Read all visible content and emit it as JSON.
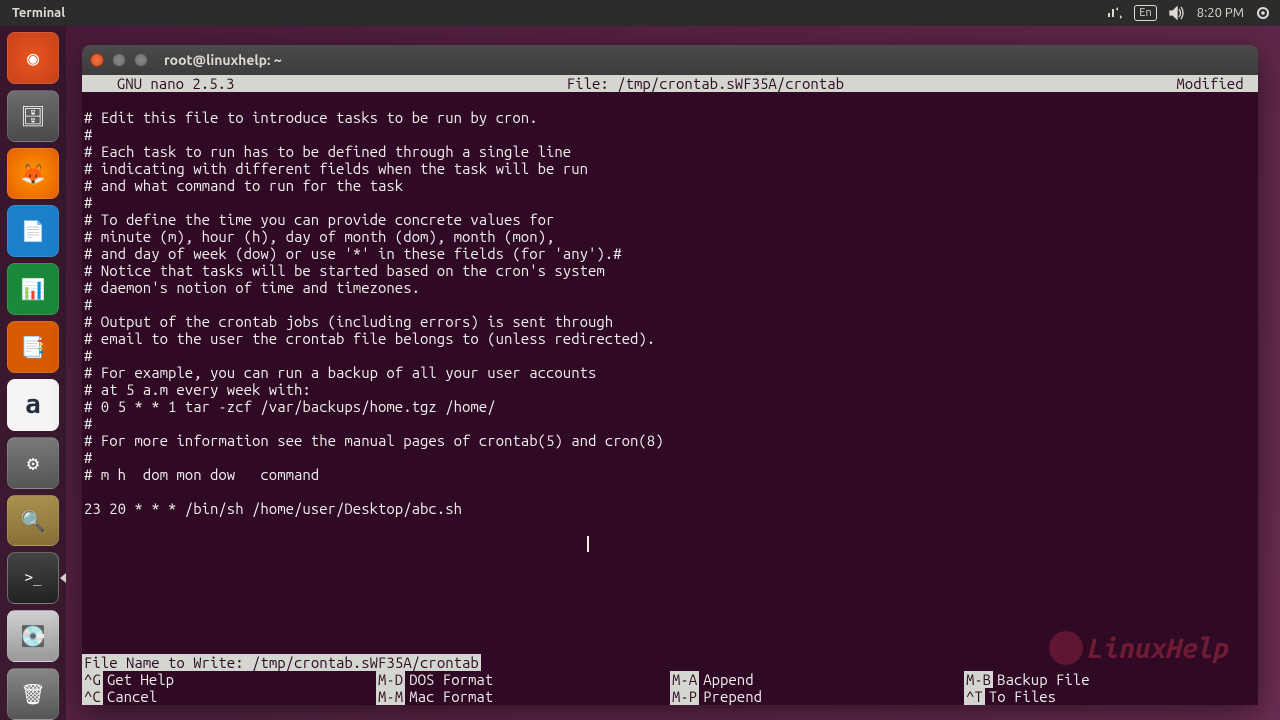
{
  "topbar": {
    "title": "Terminal",
    "lang": "En",
    "time": "8:20 PM"
  },
  "launcher": [
    {
      "name": "ubuntu"
    },
    {
      "name": "files"
    },
    {
      "name": "firefox"
    },
    {
      "name": "writer"
    },
    {
      "name": "calc"
    },
    {
      "name": "impress"
    },
    {
      "name": "amazon"
    },
    {
      "name": "settings"
    },
    {
      "name": "search"
    },
    {
      "name": "terminal"
    },
    {
      "name": "disk"
    },
    {
      "name": "trash"
    }
  ],
  "window": {
    "title": "root@linuxhelp: ~"
  },
  "nano": {
    "app": "  GNU nano 2.5.3",
    "file_label": "File: /tmp/crontab.sWF35A/crontab",
    "status": "Modified ",
    "content": "# Edit this file to introduce tasks to be run by cron.\n#\n# Each task to run has to be defined through a single line\n# indicating with different fields when the task will be run\n# and what command to run for the task\n#\n# To define the time you can provide concrete values for\n# minute (m), hour (h), day of month (dom), month (mon),\n# and day of week (dow) or use '*' in these fields (for 'any').#\n# Notice that tasks will be started based on the cron's system\n# daemon's notion of time and timezones.\n#\n# Output of the crontab jobs (including errors) is sent through\n# email to the user the crontab file belongs to (unless redirected).\n#\n# For example, you can run a backup of all your user accounts\n# at 5 a.m every week with:\n# 0 5 * * 1 tar -zcf /var/backups/home.tgz /home/\n#\n# For more information see the manual pages of crontab(5) and cron(8)\n#\n# m h  dom mon dow   command\n\n23 20 * * * /bin/sh /home/user/Desktop/abc.sh",
    "write_prompt": "File Name to Write: ",
    "write_value": "/tmp/crontab.sWF35A/crontab",
    "shortcuts": {
      "r1": [
        {
          "k": "^G",
          "l": "Get Help"
        },
        {
          "k": "M-D",
          "l": "DOS Format"
        },
        {
          "k": "M-A",
          "l": "Append"
        },
        {
          "k": "M-B",
          "l": "Backup File"
        }
      ],
      "r2": [
        {
          "k": "^C",
          "l": "Cancel"
        },
        {
          "k": "M-M",
          "l": "Mac Format"
        },
        {
          "k": "M-P",
          "l": "Prepend"
        },
        {
          "k": "^T",
          "l": "To Files"
        }
      ]
    }
  },
  "watermark": "LinuxHelp"
}
